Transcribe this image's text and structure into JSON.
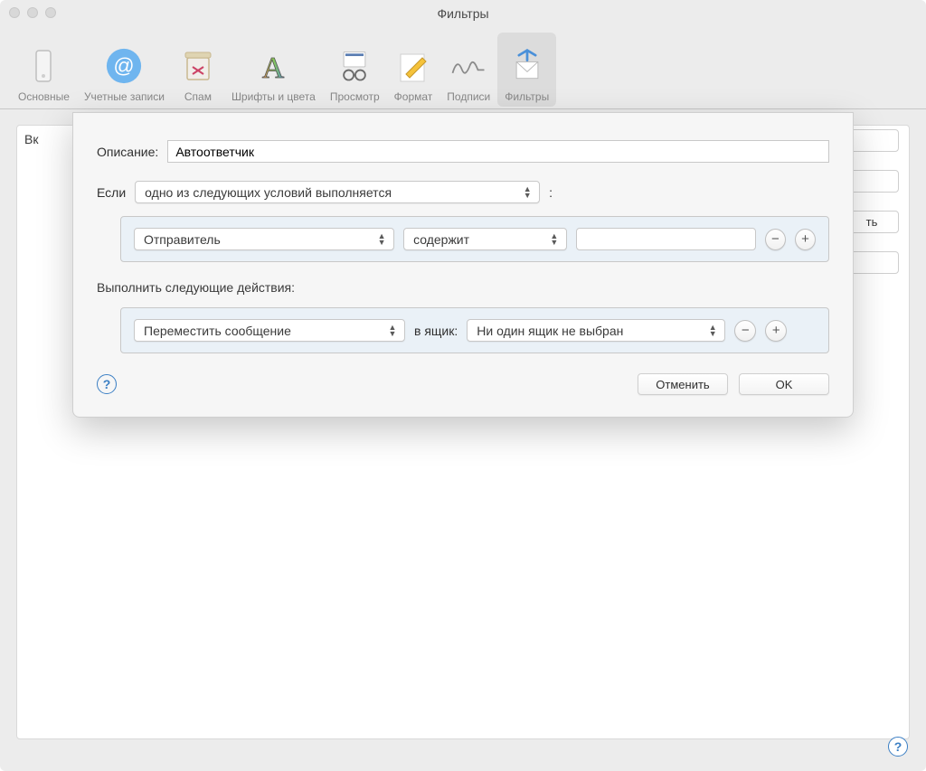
{
  "window": {
    "title": "Фильтры"
  },
  "toolbar": {
    "general": "Основные",
    "accounts": "Учетные записи",
    "junk": "Спам",
    "fonts": "Шрифты и цвета",
    "viewing": "Просмотр",
    "composing": "Формат",
    "signatures": "Подписи",
    "rules": "Фильтры"
  },
  "background": {
    "left_label": "Вк",
    "right_partial": "ть"
  },
  "sheet": {
    "description_label": "Описание:",
    "description_value": "Автоответчик",
    "if_label": "Если",
    "if_combo": "одно из следующих условий выполняется",
    "colon": ":",
    "condition": {
      "field": "Отправитель",
      "op": "содержит",
      "value": ""
    },
    "actions_label": "Выполнить следующие действия:",
    "action": {
      "type": "Переместить сообщение",
      "to_label": "в ящик:",
      "mailbox": "Ни один ящик не выбран"
    },
    "cancel": "Отменить",
    "ok": "OK"
  }
}
